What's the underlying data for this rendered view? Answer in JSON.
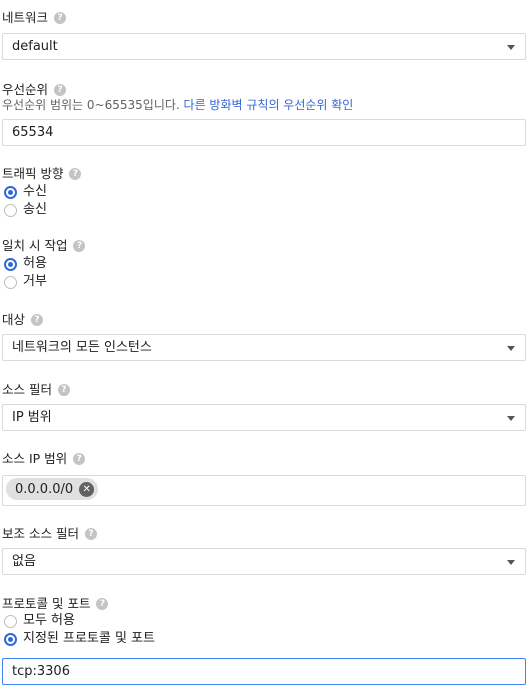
{
  "network": {
    "label": "네트워크",
    "value": "default"
  },
  "priority": {
    "label": "우선순위",
    "description": "우선순위 범위는 0~65535입니다. ",
    "link": "다른 방화벽 규칙의 우선순위 확인",
    "value": "65534"
  },
  "traffic_direction": {
    "label": "트래픽 방향",
    "options": [
      {
        "label": "수신",
        "selected": true
      },
      {
        "label": "송신",
        "selected": false
      }
    ]
  },
  "action_on_match": {
    "label": "일치 시 작업",
    "options": [
      {
        "label": "허용",
        "selected": true
      },
      {
        "label": "거부",
        "selected": false
      }
    ]
  },
  "targets": {
    "label": "대상",
    "value": "네트워크의 모든 인스턴스"
  },
  "source_filter": {
    "label": "소스 필터",
    "value": "IP 범위"
  },
  "source_ip_ranges": {
    "label": "소스 IP 범위",
    "chips": [
      "0.0.0.0/0"
    ]
  },
  "second_source_filter": {
    "label": "보조 소스 필터",
    "value": "없음"
  },
  "protocols_ports": {
    "label": "프로토콜 및 포트",
    "options": [
      {
        "label": "모두 허용",
        "selected": false
      },
      {
        "label": "지정된 프로토콜 및 포트",
        "selected": true
      }
    ],
    "value": "tcp:3306"
  },
  "icons": {
    "help": "help-icon",
    "dropdown": "caret-down-icon",
    "chip_remove": "close-circle-icon"
  }
}
